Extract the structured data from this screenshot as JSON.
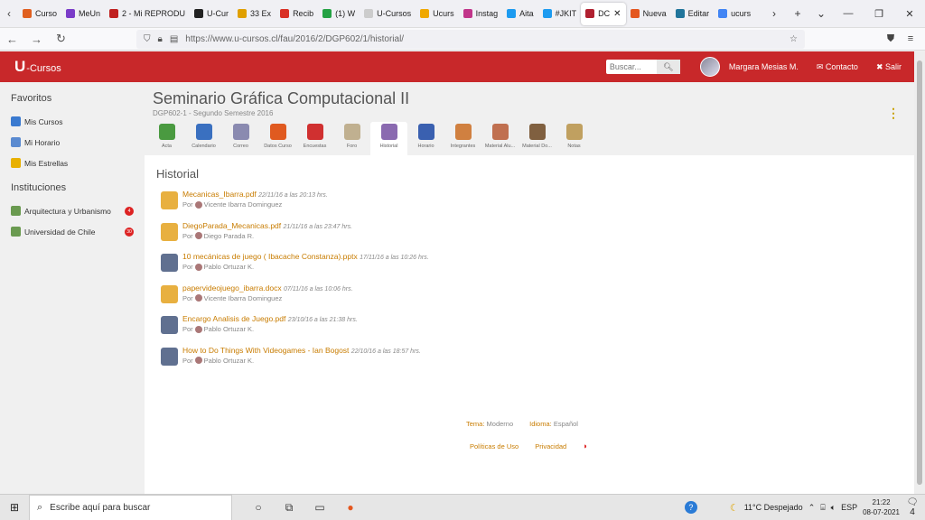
{
  "browser": {
    "tabs": [
      {
        "label": "Curso",
        "color": "#e06020",
        "active": false
      },
      {
        "label": "MeUn",
        "color": "#7a3cc8",
        "active": false
      },
      {
        "label": "2 - Mi REPRODU",
        "color": "#c02020",
        "active": false
      },
      {
        "label": "U-Cur",
        "color": "#222222",
        "active": false
      },
      {
        "label": "33 Ex",
        "color": "#e0a000",
        "active": false
      },
      {
        "label": "Recib",
        "color": "#d93025",
        "active": false
      },
      {
        "label": "(1) W",
        "color": "#25a244",
        "active": false
      },
      {
        "label": "U-Cursos",
        "color": "#cccccc",
        "active": false
      },
      {
        "label": "Ucurs",
        "color": "#f0a800",
        "active": false
      },
      {
        "label": "Instag",
        "color": "#c1358a",
        "active": false
      },
      {
        "label": "Aita",
        "color": "#1d9bf0",
        "active": false
      },
      {
        "label": "#JKIT",
        "color": "#1d9bf0",
        "active": false
      },
      {
        "label": "DC",
        "color": "#b02030",
        "active": true
      },
      {
        "label": "Nueva",
        "color": "#e4571f",
        "active": false
      },
      {
        "label": "Editar",
        "color": "#21759b",
        "active": false
      },
      {
        "label": "ucurs",
        "color": "#4285f4",
        "active": false
      }
    ],
    "url": "https://www.u-cursos.cl/fau/2016/2/DGP602/1/historial/"
  },
  "header": {
    "logo_u": "U",
    "logo_rest": "-Cursos",
    "search_placeholder": "Buscar...",
    "user_name": "Margara Mesias M.",
    "contact_label": "✉ Contacto",
    "logout_label": "✖ Salir"
  },
  "sidebar": {
    "favorites_heading": "Favoritos",
    "favorites": [
      {
        "label": "Mis Cursos",
        "color": "#3a7ad0"
      },
      {
        "label": "Mi Horario",
        "color": "#5a8ad0"
      },
      {
        "label": "Mis Estrellas",
        "color": "#e8b000"
      }
    ],
    "institutions_heading": "Instituciones",
    "institutions": [
      {
        "label": "Arquitectura y Urbanismo",
        "badge": "4",
        "color": "#6a9a50"
      },
      {
        "label": "Universidad de Chile",
        "badge": "30",
        "color": "#6a9a50"
      }
    ]
  },
  "course": {
    "title": "Seminario Gráfica Computacional II",
    "subtitle": "DGP602-1 - Segundo Semestre 2016",
    "kebab": "⋮",
    "tools": [
      {
        "label": "Acta",
        "color": "#4a9a40",
        "active": false
      },
      {
        "label": "Calendario",
        "color": "#3a70c0",
        "active": false
      },
      {
        "label": "Correo",
        "color": "#8a8ab0",
        "active": false
      },
      {
        "label": "Datos Curso",
        "color": "#e05a20",
        "active": false
      },
      {
        "label": "Encuestas",
        "color": "#d03030",
        "active": false
      },
      {
        "label": "Foro",
        "color": "#c0b090",
        "active": false
      },
      {
        "label": "Historial",
        "color": "#8a6ab0",
        "active": true
      },
      {
        "label": "Horario",
        "color": "#3a60b0",
        "active": false
      },
      {
        "label": "Integrantes",
        "color": "#d08040",
        "active": false
      },
      {
        "label": "Material Alu...",
        "color": "#c07050",
        "active": false
      },
      {
        "label": "Material Do...",
        "color": "#806040",
        "active": false
      },
      {
        "label": "Notas",
        "color": "#c0a060",
        "active": false
      }
    ]
  },
  "historial": {
    "title": "Historial",
    "by_label": "Por",
    "items": [
      {
        "file": "Mecanicas_Ibarra.pdf",
        "date": "22/11/16 a las 20:13 hrs.",
        "author": "Vicente Ibarra Dominguez",
        "icon_color": "#e8b040"
      },
      {
        "file": "DiegoParada_Mecanicas.pdf",
        "date": "21/11/16 a las 23:47 hrs.",
        "author": "Diego Parada R.",
        "icon_color": "#e8b040"
      },
      {
        "file": "10 mecánicas de juego ( Ibacache Constanza).pptx",
        "date": "17/11/16 a las 10:26 hrs.",
        "author": "Pablo Ortuzar K.",
        "icon_color": "#607090"
      },
      {
        "file": "papervideojuego_ibarra.docx",
        "date": "07/11/16 a las 10:06 hrs.",
        "author": "Vicente Ibarra Dominguez",
        "icon_color": "#e8b040"
      },
      {
        "file": "Encargo Analisis de Juego.pdf",
        "date": "23/10/16 a las 21:38 hrs.",
        "author": "Pablo Ortuzar K.",
        "icon_color": "#607090"
      },
      {
        "file": "How to Do Things With Videogames - Ian Bogost",
        "date": "22/10/16 a las 18:57 hrs.",
        "author": "Pablo Ortuzar K.",
        "icon_color": "#607090"
      }
    ]
  },
  "footer": {
    "theme_label": "Tema:",
    "theme_value": "Moderno",
    "language_label": "Idioma:",
    "language_value": "Español",
    "policies_label": "Políticas de Uso",
    "privacy_label": "Privacidad"
  },
  "taskbar": {
    "search_text": "Escribe aquí para buscar",
    "weather": "11°C  Despejado",
    "lang": "ESP",
    "time": "21:22",
    "date": "08-07-2021",
    "notifications": "4"
  }
}
